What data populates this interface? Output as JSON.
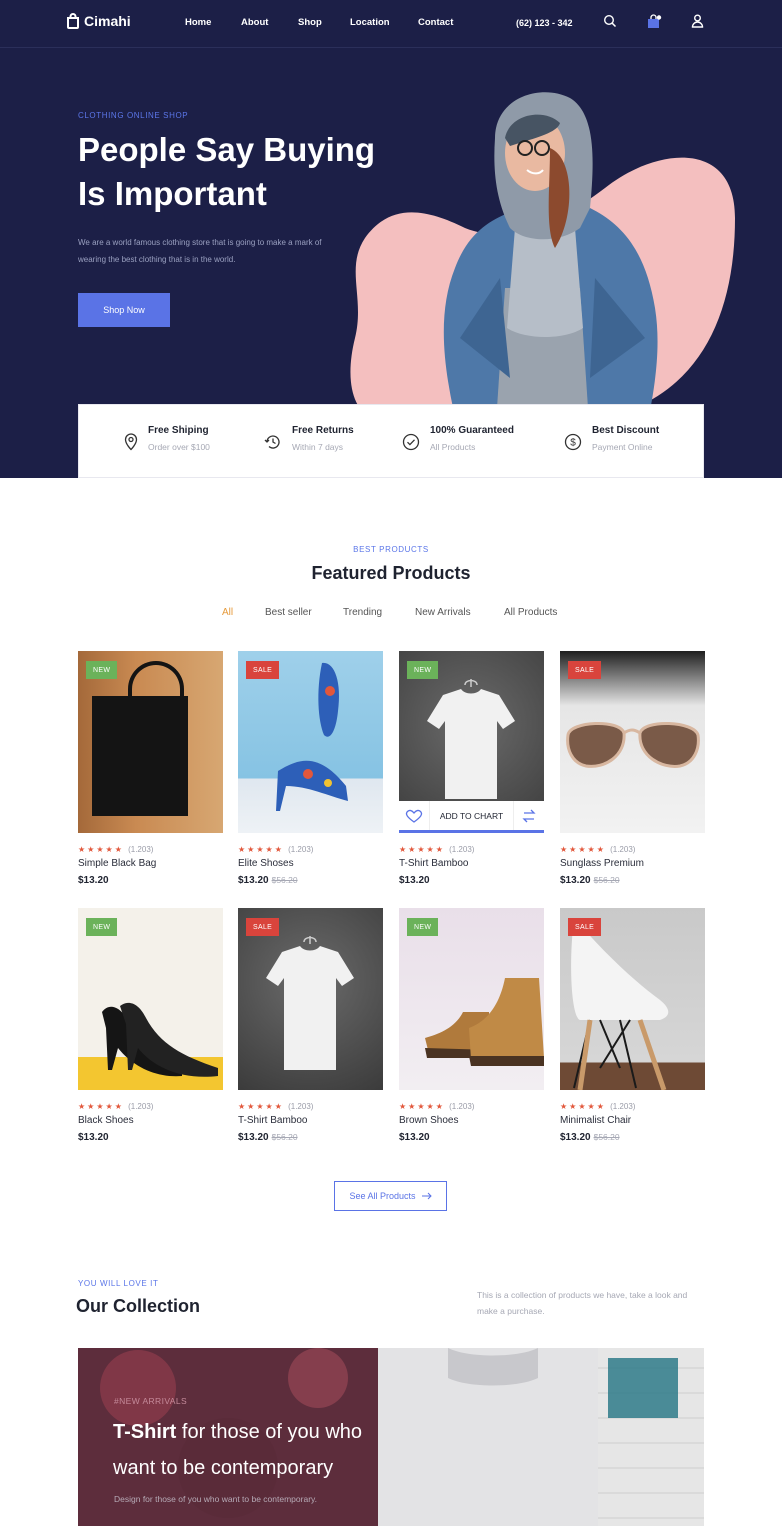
{
  "brand": {
    "name": "Cimahi"
  },
  "nav": {
    "links": [
      "Home",
      "About",
      "Shop",
      "Location",
      "Contact"
    ],
    "phone": "(62) 123 - 342"
  },
  "hero": {
    "eyebrow": "CLOTHING ONLINE SHOP",
    "title_line1": "People Say Buying",
    "title_line2": "Is Important",
    "description": "We are a world famous clothing store that is going to make a mark of wearing the best clothing that is in the world.",
    "cta": "Shop Now"
  },
  "features": [
    {
      "title": "Free Shiping",
      "subtitle": "Order over $100",
      "icon": "location-pin-icon"
    },
    {
      "title": "Free Returns",
      "subtitle": "Within 7 days",
      "icon": "history-icon"
    },
    {
      "title": "100% Guaranteed",
      "subtitle": "All Products",
      "icon": "check-circle-icon"
    },
    {
      "title": "Best Discount",
      "subtitle": "Payment Online",
      "icon": "dollar-circle-icon"
    }
  ],
  "featured": {
    "eyebrow": "BEST PRODUCTS",
    "title": "Featured Products",
    "tabs": [
      "All",
      "Best seller",
      "Trending",
      "New Arrivals",
      "All Products"
    ],
    "active_tab": "All",
    "add_to_cart": "ADD TO CHART",
    "see_all": "See All Products",
    "products": [
      {
        "name": "Simple Black Bag",
        "price": "$13.20",
        "old_price": "",
        "badge": "NEW",
        "rating": "(1.203)"
      },
      {
        "name": "Elite Shoses",
        "price": "$13.20",
        "old_price": "$56.20",
        "badge": "SALE",
        "rating": "(1.203)"
      },
      {
        "name": "T-Shirt Bamboo",
        "price": "$13.20",
        "old_price": "",
        "badge": "NEW",
        "rating": "(1.203)"
      },
      {
        "name": "Sunglass Premium",
        "price": "$13.20",
        "old_price": "$56.20",
        "badge": "SALE",
        "rating": "(1.203)"
      },
      {
        "name": "Black Shoes",
        "price": "$13.20",
        "old_price": "",
        "badge": "NEW",
        "rating": "(1.203)"
      },
      {
        "name": "T-Shirt Bamboo",
        "price": "$13.20",
        "old_price": "$56.20",
        "badge": "SALE",
        "rating": "(1.203)"
      },
      {
        "name": "Brown Shoes",
        "price": "$13.20",
        "old_price": "",
        "badge": "NEW",
        "rating": "(1.203)"
      },
      {
        "name": "Minimalist Chair",
        "price": "$13.20",
        "old_price": "$56.20",
        "badge": "SALE",
        "rating": "(1.203)"
      }
    ]
  },
  "collection": {
    "eyebrow": "YOU WILL LOVE IT",
    "title": "Our Collection",
    "description": "This is a collection of products we have, take a look and make a purchase.",
    "banner": {
      "tag": "#NEW ARRIVALS",
      "headline_bold": "T-Shirt",
      "headline_rest": "for those of you who",
      "headline_line2": "want to be contemporary",
      "subtitle": "Design for those of you who want to be contemporary."
    }
  },
  "colors": {
    "navy": "#1c1f47",
    "accent": "#5a73e6",
    "pink": "#f4bfbf",
    "new": "#6bb25a",
    "sale": "#d9443c",
    "star": "#e2573b"
  }
}
